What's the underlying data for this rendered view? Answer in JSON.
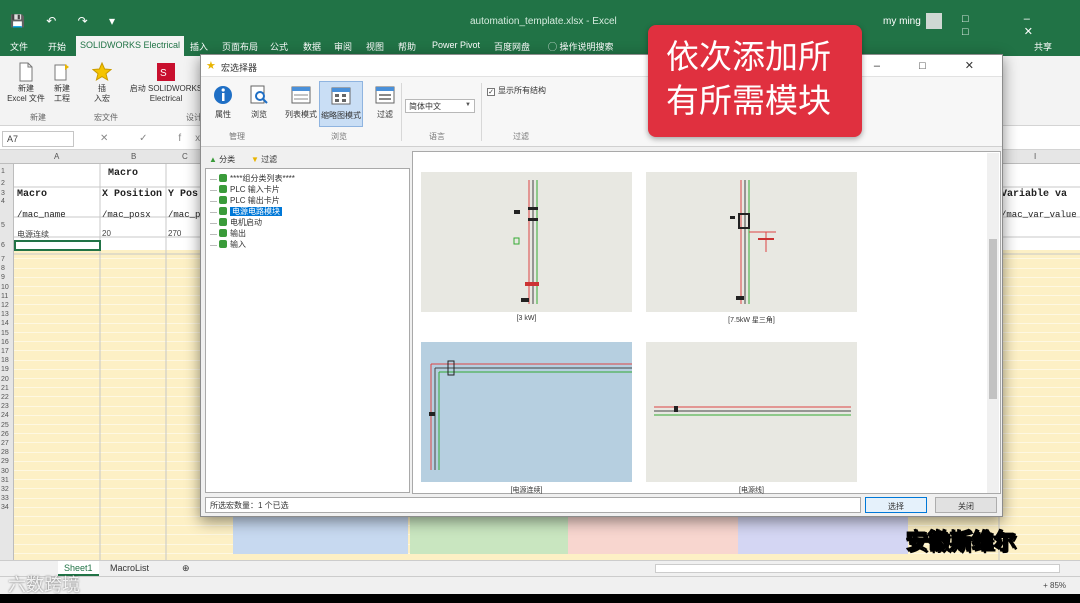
{
  "excel": {
    "title": "automation_template.xlsx - Excel",
    "qat_icons": "💾 ↶ ↷ ▾",
    "user": "my ming",
    "window_buttons": "□ – □ ✕",
    "tabs": [
      "文件",
      "开始",
      "SOLIDWORKS Electrical",
      "插入",
      "页面布局",
      "公式",
      "数据",
      "审阅",
      "视图",
      "帮助",
      "Power Pivot",
      "百度网盘",
      "操作说明搜索"
    ],
    "active_tab_index": 2,
    "share_label": "共享",
    "ribbon": {
      "new_file": "新建\nExcel 文件",
      "new_project": "新建\n工程",
      "insert": "插\n入宏",
      "launch": "启动 SOLIDWORKS\nElectrical",
      "group_new": "新建",
      "group_macro": "宏文件",
      "group_other": "设计"
    },
    "namebox": "A7",
    "fx_symbols": "✕ ✓ fx",
    "columns": [
      "A",
      "B",
      "C",
      "I"
    ],
    "rows": [
      "1",
      "2",
      "3",
      "4",
      "5",
      "6",
      "7",
      "8",
      "9",
      "10",
      "11",
      "12",
      "13",
      "14",
      "15",
      "16",
      "17",
      "18",
      "19",
      "20",
      "21",
      "22",
      "23",
      "24",
      "25",
      "26",
      "27",
      "28",
      "29",
      "30",
      "31",
      "32",
      "33",
      "34"
    ],
    "cells": {
      "macro_title": "Macro",
      "h_macro": "Macro",
      "h_xpos": "X Position",
      "h_ypos": "Y Pos",
      "h_var": "Variable va",
      "r5_macro": "/mac_name",
      "r5_xpos": "/mac_posx",
      "r5_ypos": "/mac_p",
      "r5_var": "/mac_var_value",
      "r6_macro": "电源连续",
      "r6_xpos": "20",
      "r6_ypos": "270"
    },
    "sheets": [
      "Sheet1",
      "MacroList"
    ],
    "add_sheet": "⊕",
    "zoom": "+ 85%",
    "band_colors": [
      "#c7d9f0",
      "#c9e6c0",
      "#f8d6cf",
      "#d4d6f3"
    ]
  },
  "dialog": {
    "title": "宏选择器",
    "window_controls": "– □ ✕",
    "buttons": [
      {
        "label": "属性",
        "icon": "info-icon"
      },
      {
        "label": "浏览",
        "icon": "browse-icon"
      },
      {
        "label": "列表模式",
        "icon": "list-mode-icon"
      },
      {
        "label": "缩略图模式",
        "icon": "thumbnail-mode-icon"
      },
      {
        "label": "过滤",
        "icon": "filter-icon"
      }
    ],
    "groups": {
      "manage": "管理",
      "browse": "浏览",
      "language": "语言",
      "filter": "过滤"
    },
    "language_value": "简体中文",
    "show_checkbox": "显示所有结构",
    "show_checked": true,
    "tree_toolbar": {
      "category": "分类",
      "filter": "过滤"
    },
    "tree": [
      {
        "label": "****组分类列表****",
        "selected": false
      },
      {
        "label": "PLC 输入卡片",
        "selected": false
      },
      {
        "label": "PLC 输出卡片",
        "selected": false
      },
      {
        "label": "电源电路模块",
        "selected": true
      },
      {
        "label": "电机启动",
        "selected": false
      },
      {
        "label": "输出",
        "selected": false
      },
      {
        "label": "输入",
        "selected": false
      }
    ],
    "thumbnails": [
      {
        "caption": "[3 kW]"
      },
      {
        "caption": "[7.5kW 星三角]"
      },
      {
        "caption": "[电源连续]"
      },
      {
        "caption": "[电源线]"
      }
    ],
    "status": "所选宏数量：1 个已选",
    "ok": "选择",
    "close": "关闭"
  },
  "overlay": {
    "banner_line1": "依次添加所",
    "banner_line2": "有所需模块",
    "watermark_right": "安徽斯维尔",
    "watermark_left": "六数跨境"
  }
}
